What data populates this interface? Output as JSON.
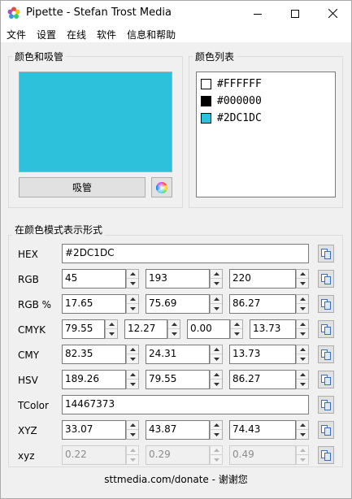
{
  "window": {
    "title": "Pipette - Stefan Trost Media"
  },
  "menu": [
    "文件",
    "设置",
    "在线",
    "软件",
    "信息和帮助"
  ],
  "color_group": {
    "title": "颜色和吸管",
    "preview_color": "#2DC1DC",
    "pipette_label": "吸管"
  },
  "list_group": {
    "title": "颜色列表",
    "items": [
      {
        "label": "#FFFFFF",
        "color": "#FFFFFF"
      },
      {
        "label": "#000000",
        "color": "#000000"
      },
      {
        "label": "#2DC1DC",
        "color": "#2DC1DC"
      }
    ]
  },
  "modes_group": {
    "title": "在颜色模式表示形式",
    "rows": {
      "hex": {
        "label": "HEX",
        "values": [
          "#2DC1DC"
        ]
      },
      "rgb": {
        "label": "RGB",
        "values": [
          "45",
          "193",
          "220"
        ]
      },
      "rgb_pct": {
        "label": "RGB %",
        "values": [
          "17.65",
          "75.69",
          "86.27"
        ]
      },
      "cmyk": {
        "label": "CMYK",
        "values": [
          "79.55",
          "12.27",
          "0.00",
          "13.73"
        ]
      },
      "cmy": {
        "label": "CMY",
        "values": [
          "82.35",
          "24.31",
          "13.73"
        ]
      },
      "hsv": {
        "label": "HSV",
        "values": [
          "189.26",
          "79.55",
          "86.27"
        ]
      },
      "tcolor": {
        "label": "TColor",
        "values": [
          "14467373"
        ]
      },
      "xyz": {
        "label": "XYZ",
        "values": [
          "33.07",
          "43.87",
          "74.43"
        ]
      },
      "xyz_small": {
        "label": "xyz",
        "values": [
          "0.22",
          "0.29",
          "0.49"
        ]
      }
    }
  },
  "footer": {
    "text": "sttmedia.com/donate - 谢谢您"
  }
}
